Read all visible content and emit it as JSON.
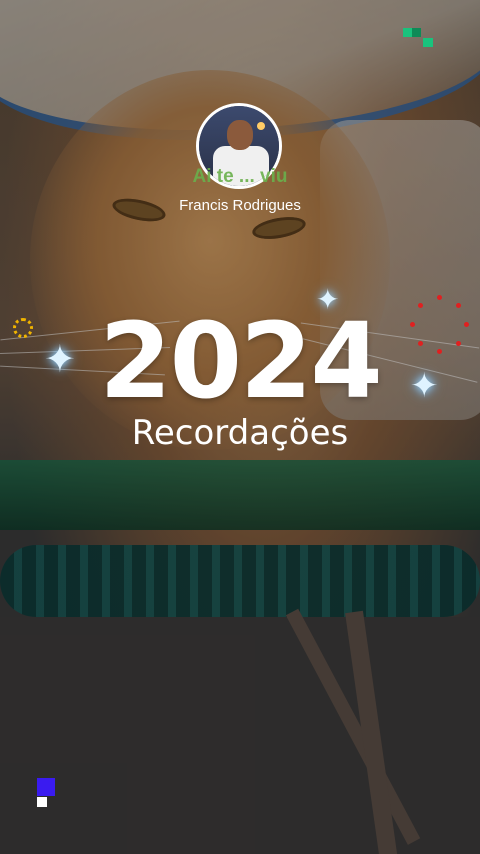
{
  "story": {
    "caption": "Ai te ... viu",
    "username": "Francis Rodrigues",
    "year": "2024",
    "subtitle": "Recordações"
  },
  "colors": {
    "caption_green": "#6ab04c",
    "ring_red": "#e02020",
    "sparkle": "#dff3ff",
    "sun_yellow": "#f0b400",
    "pixel_green": "#19c37d",
    "pixel_blue": "#3a1bf0"
  },
  "icons": {
    "sparkle": "✦"
  }
}
